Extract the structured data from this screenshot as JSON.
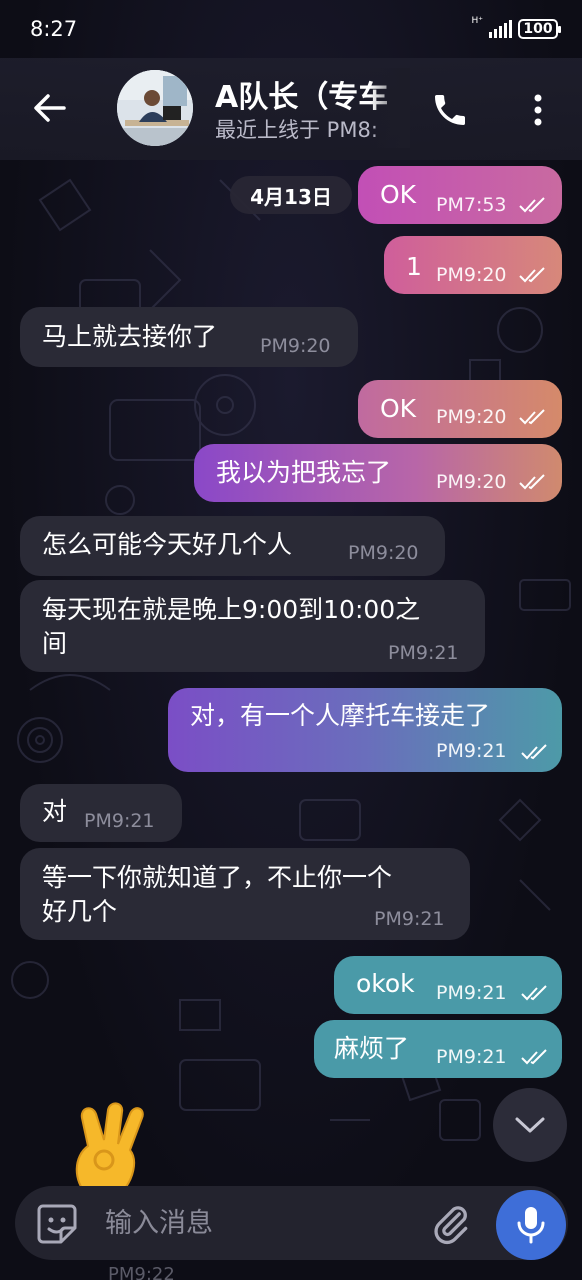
{
  "status_bar": {
    "time": "8:27",
    "network": "H⁺",
    "battery": "100"
  },
  "header": {
    "title": "A队长（专车",
    "subtitle": "最近上线于 PM8:",
    "icons": [
      "arrow-left-icon",
      "phone-icon",
      "more-vert-icon"
    ]
  },
  "date_chip": "4月13日",
  "messages": [
    {
      "direction": "out",
      "text": "OK",
      "time": "PM7:53",
      "read": true
    },
    {
      "direction": "out",
      "text": "1",
      "time": "PM9:20",
      "read": true
    },
    {
      "direction": "in",
      "text": "马上就去接你了",
      "time": "PM9:20"
    },
    {
      "direction": "out",
      "text": "OK",
      "time": "PM9:20",
      "read": true
    },
    {
      "direction": "out",
      "text": "我以为把我忘了",
      "time": "PM9:20",
      "read": true
    },
    {
      "direction": "in",
      "text": "怎么可能今天好几个人",
      "time": "PM9:20"
    },
    {
      "direction": "in",
      "text_lines": [
        "每天现在就是晚上9:00到10:00之",
        "间"
      ],
      "time": "PM9:21"
    },
    {
      "direction": "out",
      "text": "对，有一个人摩托车接走了",
      "time": "PM9:21",
      "read": true
    },
    {
      "direction": "in",
      "text": "对",
      "time": "PM9:21"
    },
    {
      "direction": "in",
      "text_lines": [
        "等一下你就知道了，不止你一个",
        "好几个"
      ],
      "time": "PM9:21"
    },
    {
      "direction": "out",
      "text": "okok",
      "time": "PM9:21",
      "read": true
    },
    {
      "direction": "out",
      "text": "麻烦了",
      "time": "PM9:21",
      "read": true
    }
  ],
  "peek_time": "PM9:22",
  "composer": {
    "placeholder": "输入消息"
  },
  "colors": {
    "out_pink": "#c24fb6",
    "out_orange": "#d88a6a",
    "out_purple": "#8a48c8",
    "out_teal": "#4a9aa8",
    "in_bubble": "#2a2a36",
    "mic": "#3e6ed8"
  }
}
